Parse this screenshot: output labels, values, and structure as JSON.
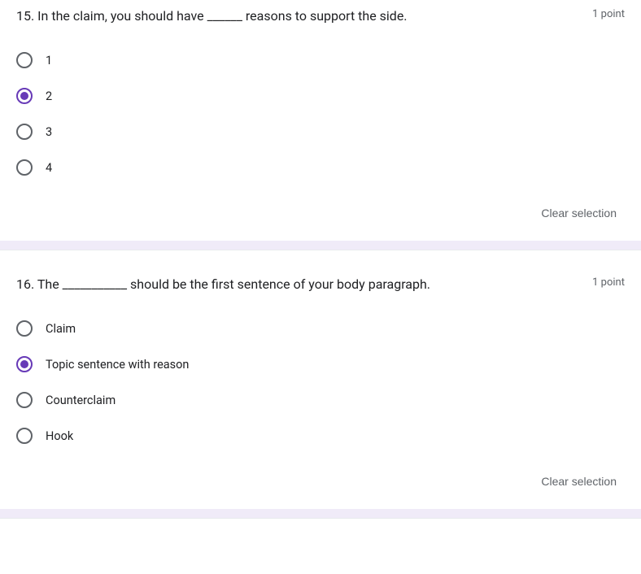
{
  "questions": [
    {
      "text": "15. In the claim, you should have ______ reasons to support the side.",
      "points": "1 point",
      "options": [
        "1",
        "2",
        "3",
        "4"
      ],
      "selectedIndex": 1,
      "clear": "Clear selection"
    },
    {
      "text": "16. The ___________ should be the first sentence of your body paragraph.",
      "points": "1 point",
      "options": [
        "Claim",
        "Topic sentence with reason",
        "Counterclaim",
        "Hook"
      ],
      "selectedIndex": 1,
      "clear": "Clear selection"
    }
  ]
}
